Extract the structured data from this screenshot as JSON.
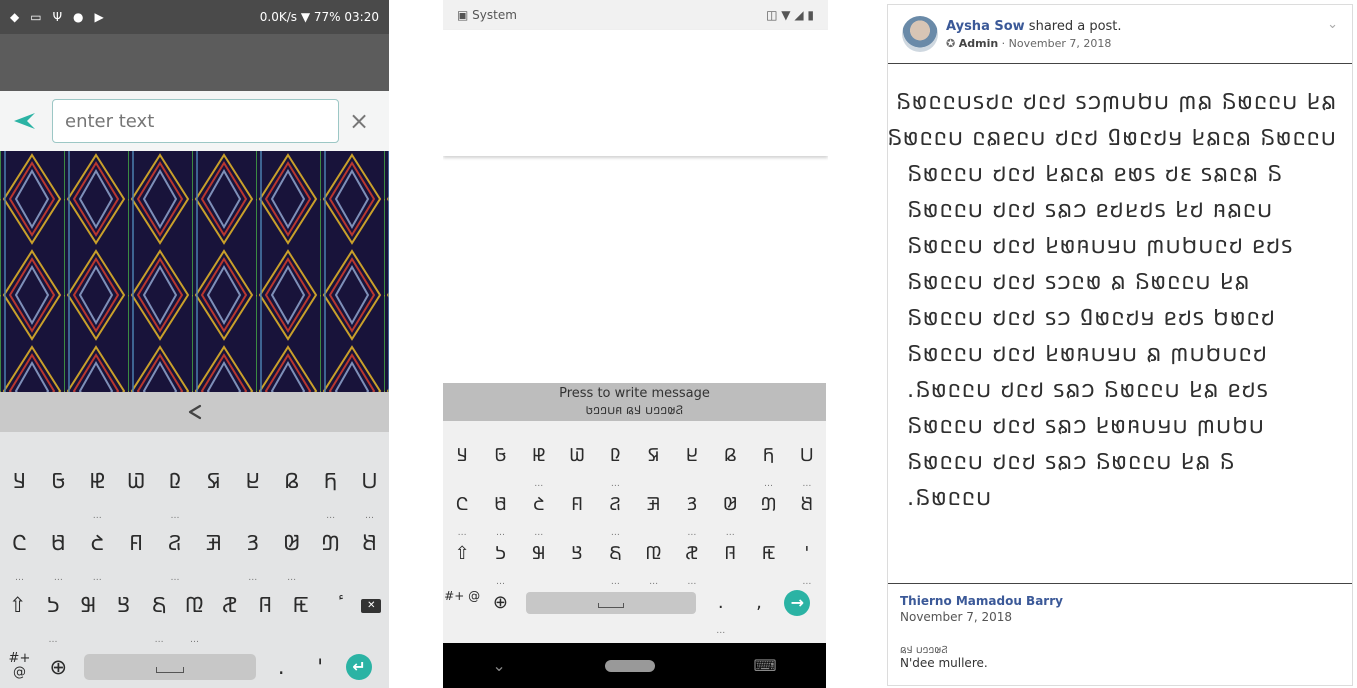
{
  "panel1": {
    "status": {
      "icons": [
        "shield-icon",
        "keyboard-icon",
        "usb-icon",
        "android-icon",
        "flag-icon"
      ],
      "speed": "0.0K/s",
      "battery": "77%",
      "time": "03:20"
    },
    "search": {
      "placeholder": "enter text",
      "close_label": "×"
    },
    "share_icon": "share-icon",
    "keyboard": {
      "row1": [
        "𞤁",
        "𞤀",
        "𞤄",
        "𞤅",
        "𞤆",
        "𞤇",
        "𞤈",
        "𞤉",
        "𞤊",
        "𞤋"
      ],
      "row2": [
        "𞤌",
        "𞤍",
        "𞤎",
        "𞤏",
        "𞤐",
        "𞤑",
        "𞤒",
        "𞤓",
        "𞤔",
        "𞤕"
      ],
      "row3": [
        "𞤖",
        "𞤗",
        "𞤘",
        "𞤙",
        "𞤚",
        "𞤛",
        "𞤜",
        "𞤝",
        "ٔ"
      ],
      "symbols_label": "#+\n@",
      "period": ".",
      "apostrophe": "'"
    }
  },
  "panel2": {
    "status": {
      "app": "System"
    },
    "message_bar": {
      "label": "Press to write message",
      "mirror": "𞤐𞤵𞤤𞤤𞤭 𞤣𞤫 𞤱𞤭𞤤𞤤𞤢"
    },
    "keyboard": {
      "row1": [
        "𞤁",
        "𞤀",
        "𞤄",
        "𞤅",
        "𞤆",
        "𞤇",
        "𞤈",
        "𞤉",
        "𞤊",
        "𞤋"
      ],
      "row2": [
        "𞤌",
        "𞤍",
        "𞤎",
        "𞤏",
        "𞤐",
        "𞤑",
        "𞤒",
        "𞤓",
        "𞤔",
        "𞤕"
      ],
      "row3": [
        "𞤖",
        "𞤗",
        "𞤘",
        "𞤙",
        "𞤚",
        "𞤛",
        "𞤜",
        "𞤝",
        "'"
      ],
      "symbols_label": "#+\n@",
      "period": ".",
      "comma": ","
    }
  },
  "panel3": {
    "author": "Aysha Sow",
    "action": " shared a post.",
    "role": "Admin",
    "date": "November 7, 2018",
    "post_lines": [
      "𞤐𞤵𞤤𞤤𞤭𞤲𞤢𞤤 𞤢𞤤𞤢 𞤲𞤮𞤶𞤭𞤯𞤭 𞤶𞤫 𞤐𞤵𞤤𞤤𞤭 𞤣𞤫",
      "𞤐𞤵𞤤𞤤𞤭 𞤤𞤫𞤥𞤤𞤭 𞤢𞤤𞤢 𞤆𞤵𞤤𞤢𞤪 𞤣𞤫𞤤𞤫 𞤐𞤵𞤤𞤤𞤭",
      "𞤐𞤵𞤤𞤤𞤭 𞤢𞤤𞤢 𞤣𞤫𞤤𞤫 𞤥𞤵𞤲 𞤢𞤴 𞤲𞤫𞤤𞤫 𞤐",
      "𞤐𞤵𞤤𞤤𞤭 𞤢𞤤𞤢 𞤲𞤫𞤮 𞤥𞤢𞤣𞤢𞤲 𞤣𞤢 𞤱𞤫𞤤𞤭",
      "𞤐𞤵𞤤𞤤𞤭 𞤢𞤤𞤢 𞤣𞤵𞤱𞤭𞤪𞤭 𞤶𞤭𞤯𞤭𞤤𞤢 𞤥𞤢𞤲",
      "𞤐𞤵𞤤𞤤𞤭 𞤢𞤤𞤢 𞤲𞤮𞤤𞤵 𞤫 𞤐𞤵𞤤𞤤𞤭 𞤣𞤫",
      "𞤐𞤵𞤤𞤤𞤭 𞤢𞤤𞤢 𞤲𞤮 𞤆𞤵𞤤𞤢𞤪 𞤥𞤢𞤲 𞤯𞤵𞤤𞤢",
      "𞤐𞤵𞤤𞤤𞤭 𞤢𞤤𞤢 𞤣𞤵𞤱𞤭𞤪𞤭 𞤫 𞤶𞤭𞤯𞤭𞤤𞤢",
      "𞤐𞤵𞤤𞤤𞤭 𞤢𞤤𞤢 𞤲𞤫𞤮 𞤐𞤵𞤤𞤤𞤭 𞤣𞤫 𞤥𞤢𞤲.",
      "𞤐𞤵𞤤𞤤𞤭 𞤢𞤤𞤢 𞤲𞤫𞤮 𞤣𞤵𞤱𞤭𞤪𞤭 𞤶𞤭𞤯𞤭",
      "𞤐𞤵𞤤𞤤𞤭 𞤢𞤤𞤢 𞤲𞤫𞤮 𞤐𞤵𞤤𞤤𞤭 𞤣𞤫 𞤐",
      "𞤐𞤵𞤤𞤤𞤭."
    ],
    "comment": {
      "author": "Thierno Mamadou Barry",
      "date": "November 7, 2018",
      "adlam": "𞤐𞤵𞤤𞤤𞤭 𞤣𞤫",
      "text": "N'dee mullere."
    }
  },
  "colors": {
    "accent": "#2bb3a4",
    "link": "#3b5998",
    "pattern_bg": "#18133a"
  }
}
